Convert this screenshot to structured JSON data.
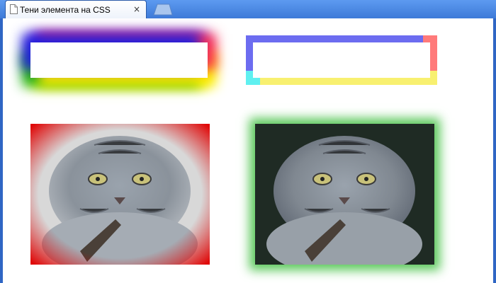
{
  "tab": {
    "title": "Тени элемента на CSS",
    "close_glyph": "×"
  },
  "icons": {
    "page": "document-icon",
    "close": "close-icon",
    "new_tab": "new-tab-icon"
  },
  "colors": {
    "chrome": "#3a78d6",
    "photo1_shadow": "#e00000",
    "photo2_shadow": "#5cc95c",
    "box1_shadows": [
      "#2020e0",
      "#7000c8",
      "#ff3050",
      "#ffee00",
      "#18b018"
    ],
    "box2_shadows": [
      "#6c6cf0",
      "#7050c8",
      "#ff7a7a",
      "#f8f070",
      "#80f8c8",
      "#60f0f0"
    ]
  },
  "images": [
    {
      "subject": "pallas-cat",
      "shadow": "red inset glow"
    },
    {
      "subject": "pallas-cat",
      "shadow": "green outer glow"
    }
  ]
}
